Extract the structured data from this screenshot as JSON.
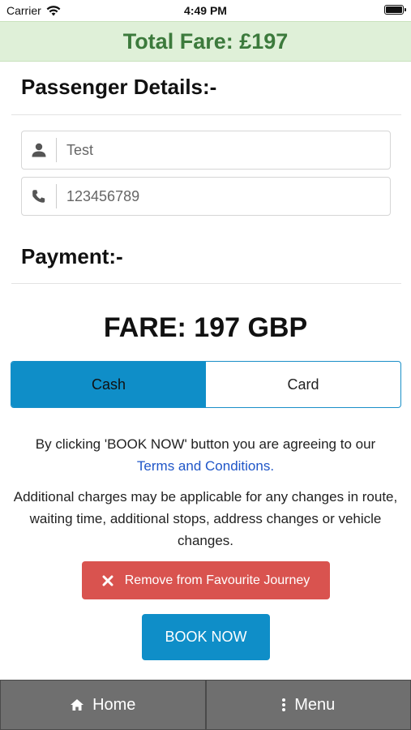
{
  "status_bar": {
    "carrier": "Carrier",
    "time": "4:49 PM"
  },
  "banner": {
    "total_fare": "Total Fare: £197"
  },
  "passenger": {
    "heading": "Passenger Details:-",
    "name_value": "Test",
    "phone_value": "123456789"
  },
  "payment": {
    "heading": "Payment:-",
    "fare": "FARE: 197 GBP",
    "options": [
      "Cash",
      "Card"
    ],
    "selected": "Cash"
  },
  "notices": {
    "agree_text": "By clicking 'BOOK NOW' button you are agreeing to our",
    "terms_link": "Terms and Conditions.",
    "charges_text": "Additional charges may be applicable for any changes in route, waiting time, additional stops, address changes or vehicle changes."
  },
  "actions": {
    "remove_favourite": "Remove from Favourite Journey",
    "book_now": "BOOK NOW"
  },
  "bottom_nav": {
    "home": "Home",
    "menu": "Menu"
  },
  "colors": {
    "banner_bg": "#dff0d8",
    "banner_text": "#3c7a3c",
    "primary": "#0f8ec8",
    "danger": "#d9534f",
    "link": "#1f56c8",
    "nav_bg": "#6f6f6f"
  }
}
